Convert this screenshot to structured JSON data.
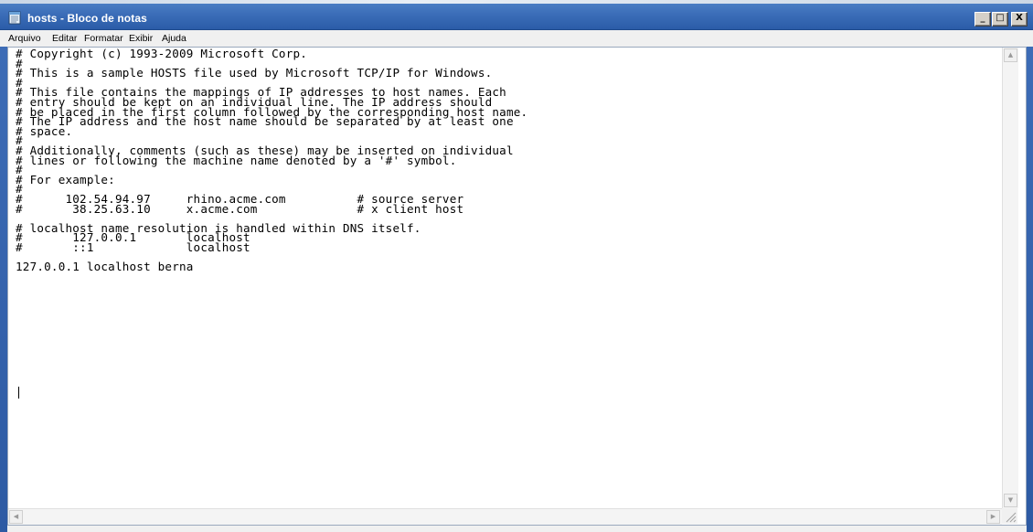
{
  "window": {
    "title": "hosts - Bloco de notas"
  },
  "caption_buttons": {
    "minimize_glyph": "_",
    "maximize_glyph": "□",
    "close_glyph": "X"
  },
  "menu": {
    "items": [
      "Arquivo",
      "Editar",
      "Formatar",
      "Exibir",
      "Ajuda"
    ]
  },
  "editor": {
    "content": "# Copyright (c) 1993-2009 Microsoft Corp.\n#\n# This is a sample HOSTS file used by Microsoft TCP/IP for Windows.\n#\n# This file contains the mappings of IP addresses to host names. Each\n# entry should be kept on an individual line. The IP address should\n# be placed in the first column followed by the corresponding host name.\n# The IP address and the host name should be separated by at least one\n# space.\n#\n# Additionally, comments (such as these) may be inserted on individual\n# lines or following the machine name denoted by a '#' symbol.\n#\n# For example:\n#\n#      102.54.94.97     rhino.acme.com          # source server\n#       38.25.63.10     x.acme.com              # x client host\n\n# localhost name resolution is handled within DNS itself.\n#\t127.0.0.1       localhost\n#\t::1             localhost\n\n127.0.0.1 localhost berna"
  },
  "icons": {
    "app": "notepad-icon",
    "scroll_up": "scroll-up-arrow-icon",
    "scroll_down": "scroll-down-arrow-icon",
    "scroll_left": "scroll-left-arrow-icon",
    "scroll_right": "scroll-right-arrow-icon",
    "size_grip": "size-grip-icon"
  },
  "colors": {
    "titlebar": "#3a6cb7",
    "title_text": "#ffffff",
    "editor_bg": "#ffffff"
  }
}
